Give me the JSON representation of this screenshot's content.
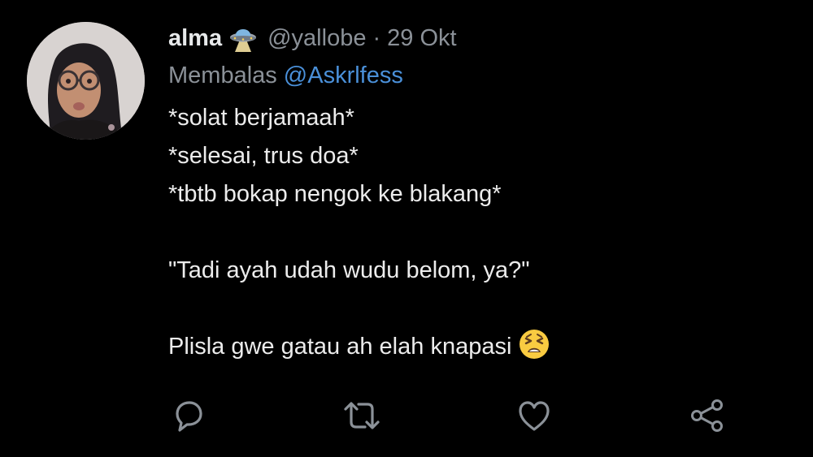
{
  "tweet": {
    "display_name": "alma",
    "name_badge_icon": "flying-saucer-emoji",
    "handle": "@yallobe",
    "separator": "·",
    "date": "29 Okt",
    "reply_prefix": "Membalas",
    "reply_to": "@Askrlfess",
    "body_lines": [
      "*solat berjamaah*",
      "*selesai, trus doa*",
      "*tbtb bokap nengok ke blakang*",
      "",
      "\"Tadi ayah udah wudu belom, ya?\"",
      "",
      "Plisla gwe gatau ah elah knapasi"
    ],
    "trailing_emoji": "tired-face-emoji"
  },
  "actions": [
    {
      "name": "reply",
      "icon": "reply-icon"
    },
    {
      "name": "retweet",
      "icon": "retweet-icon"
    },
    {
      "name": "like",
      "icon": "heart-icon"
    },
    {
      "name": "share",
      "icon": "share-icon"
    }
  ],
  "colors": {
    "background": "#000000",
    "text": "#e7e9ea",
    "muted": "#8b9198",
    "link": "#4a90d9",
    "icon": "#8b9198"
  }
}
